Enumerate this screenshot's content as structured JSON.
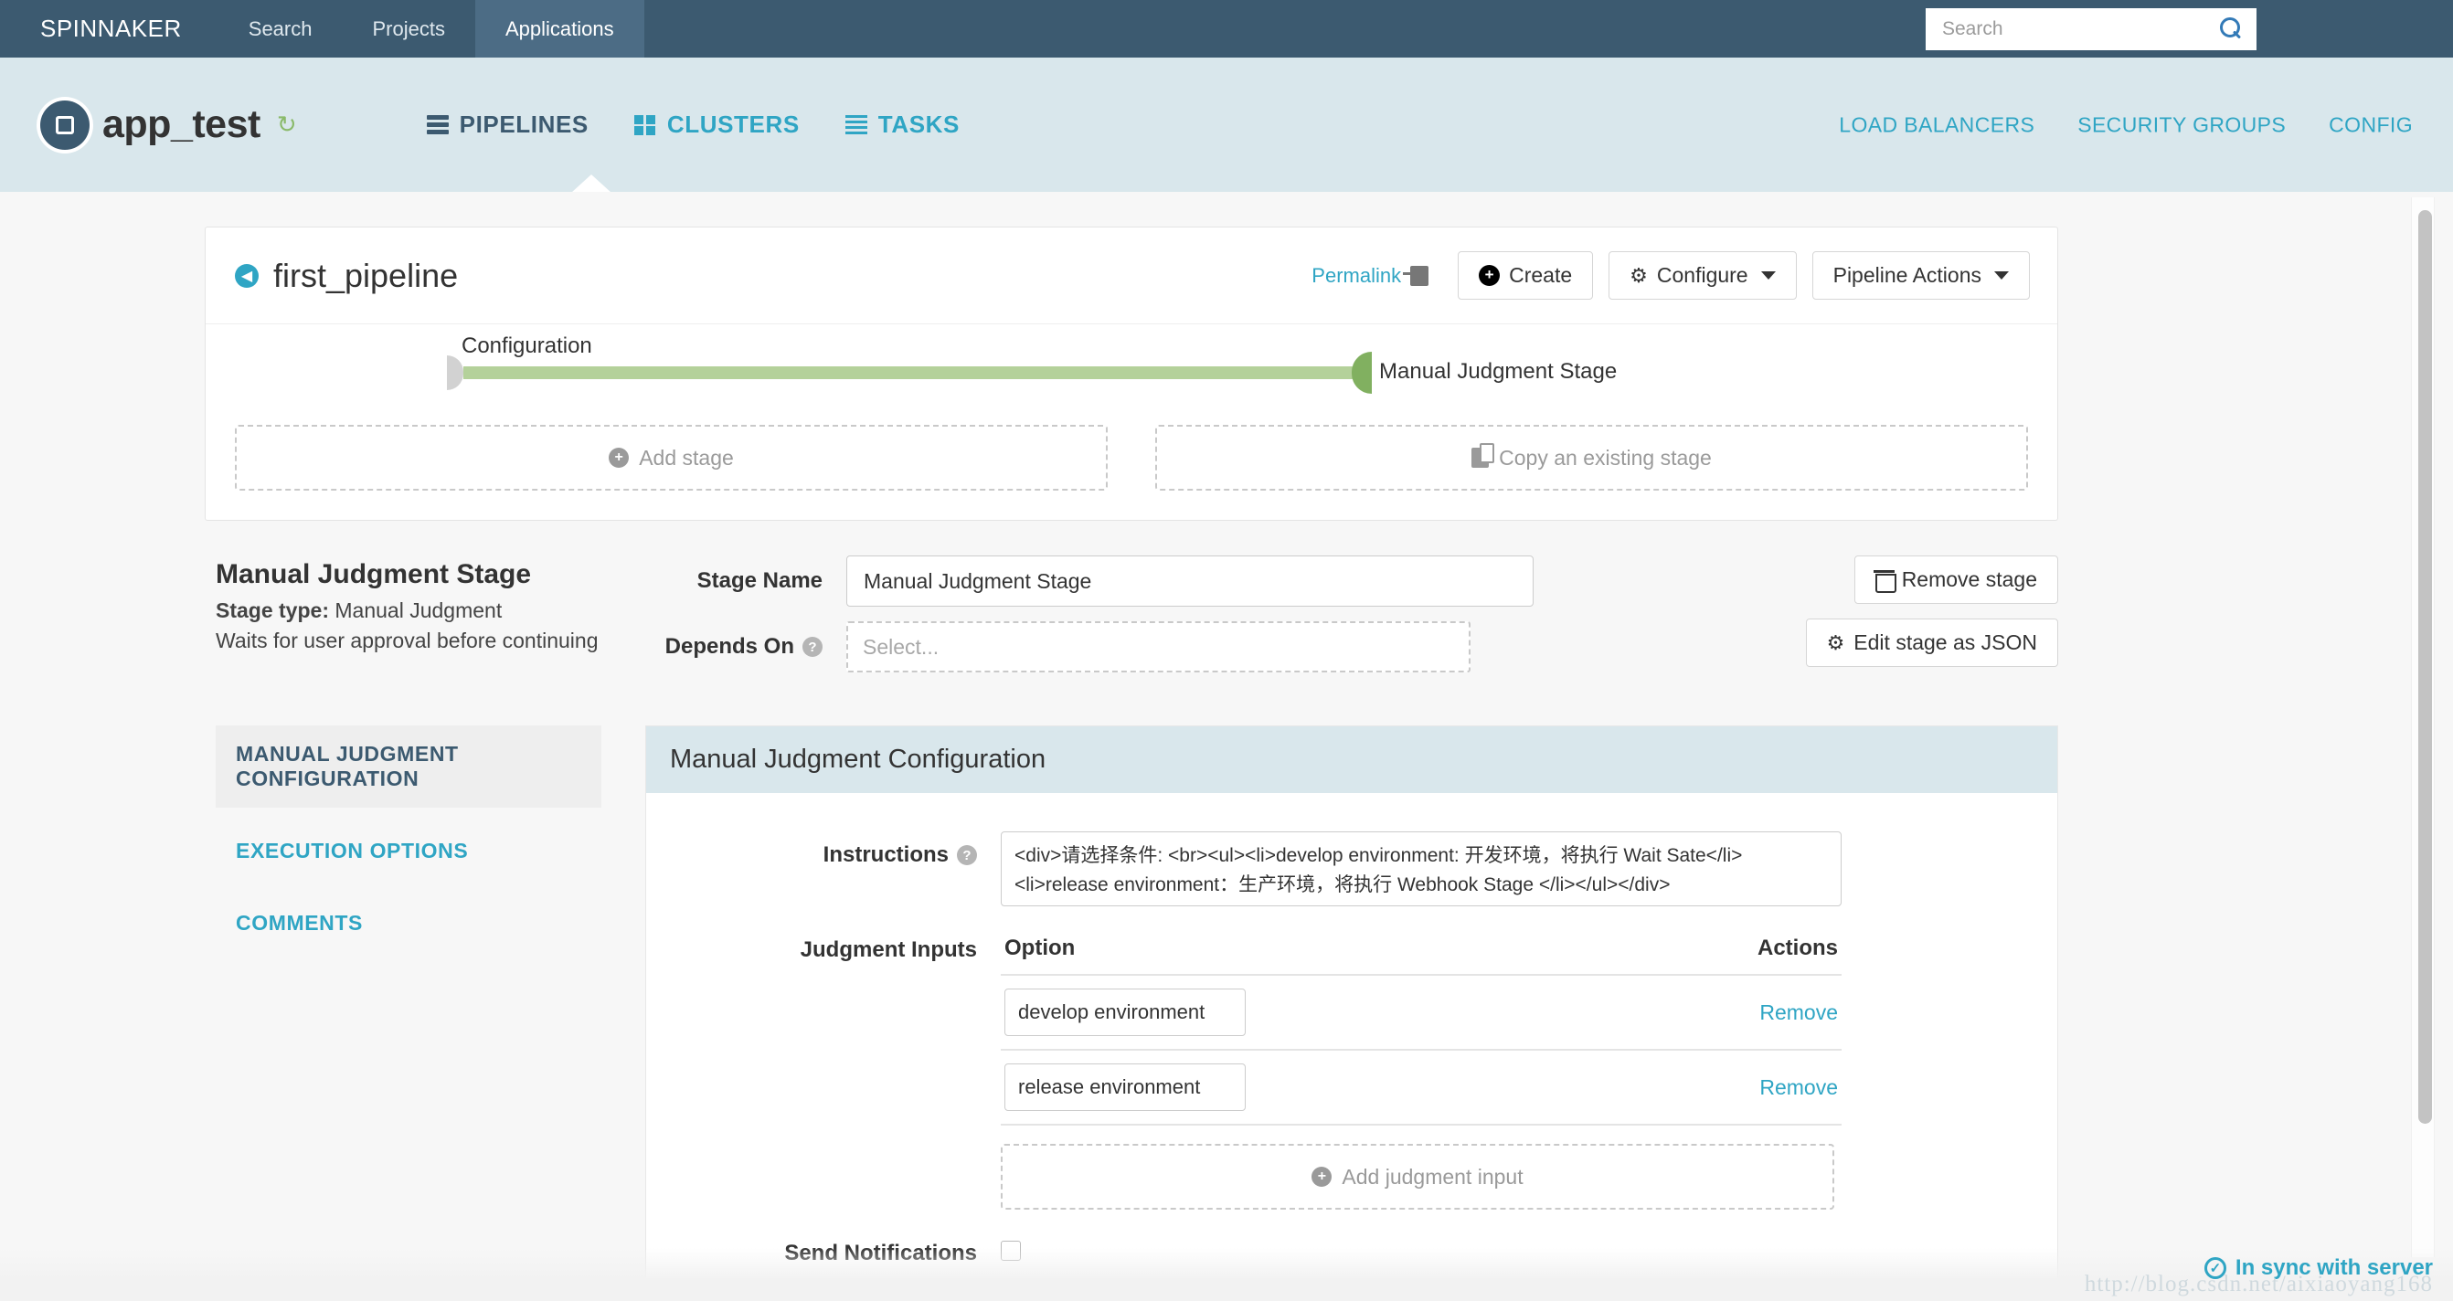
{
  "topnav": {
    "brand": "SPINNAKER",
    "links": [
      {
        "label": "Search",
        "active": false
      },
      {
        "label": "Projects",
        "active": false
      },
      {
        "label": "Applications",
        "active": true
      }
    ],
    "search": {
      "value": "",
      "placeholder": "Search",
      "icon": "search-icon"
    }
  },
  "appheader": {
    "app_name": "app_test",
    "refresh_icon": "refresh-icon",
    "tabs": [
      {
        "label": "PIPELINES",
        "icon": "bars-icon",
        "active": true
      },
      {
        "label": "CLUSTERS",
        "icon": "grid-icon",
        "active": false
      },
      {
        "label": "TASKS",
        "icon": "list-icon",
        "active": false
      }
    ],
    "right_links": [
      "LOAD BALANCERS",
      "SECURITY GROUPS",
      "CONFIG"
    ]
  },
  "pipeline": {
    "title": "first_pipeline",
    "permalink_label": "Permalink",
    "buttons": {
      "create": "Create",
      "configure": "Configure",
      "pipeline_actions": "Pipeline Actions"
    },
    "graph": {
      "config_label": "Configuration",
      "stage_label": "Manual Judgment Stage"
    },
    "add_stage": "Add stage",
    "copy_stage": "Copy an existing stage"
  },
  "stage": {
    "heading": "Manual Judgment Stage",
    "type_label": "Stage type:",
    "type_value": "Manual Judgment",
    "description": "Waits for user approval before continuing",
    "form": {
      "stage_name_label": "Stage Name",
      "stage_name_value": "Manual Judgment Stage",
      "depends_on_label": "Depends On",
      "depends_on_placeholder": "Select..."
    },
    "actions": {
      "remove_stage": "Remove stage",
      "edit_json": "Edit stage as JSON"
    }
  },
  "config": {
    "nav": [
      {
        "label": "MANUAL JUDGMENT CONFIGURATION",
        "active": true
      },
      {
        "label": "EXECUTION OPTIONS",
        "active": false
      },
      {
        "label": "COMMENTS",
        "active": false
      }
    ],
    "panel_title": "Manual Judgment Configuration",
    "instructions_label": "Instructions",
    "instructions_value": "<div>请选择条件: <br><ul><li>develop environment: 开发环境，将执行 Wait Sate</li><li>release environment：生产环境，将执行 Webhook Stage </li></ul></div>",
    "judgment_inputs_label": "Judgment Inputs",
    "table_headers": {
      "option": "Option",
      "actions": "Actions"
    },
    "judgment_inputs": [
      {
        "option": "develop environment",
        "action": "Remove"
      },
      {
        "option": "release environment",
        "action": "Remove"
      }
    ],
    "add_judgment_input": "Add judgment input",
    "send_notifications_label": "Send Notifications",
    "send_notifications_checked": false
  },
  "footer": {
    "sync_status": "In sync with server",
    "watermark": "http://blog.csdn.net/aixiaoyang168"
  },
  "colors": {
    "navy": "#3c5a70",
    "teal": "#2fa5c4",
    "header_bg": "#d9e7ec",
    "edge_green": "#b4d19a",
    "node_green": "#81b060"
  }
}
